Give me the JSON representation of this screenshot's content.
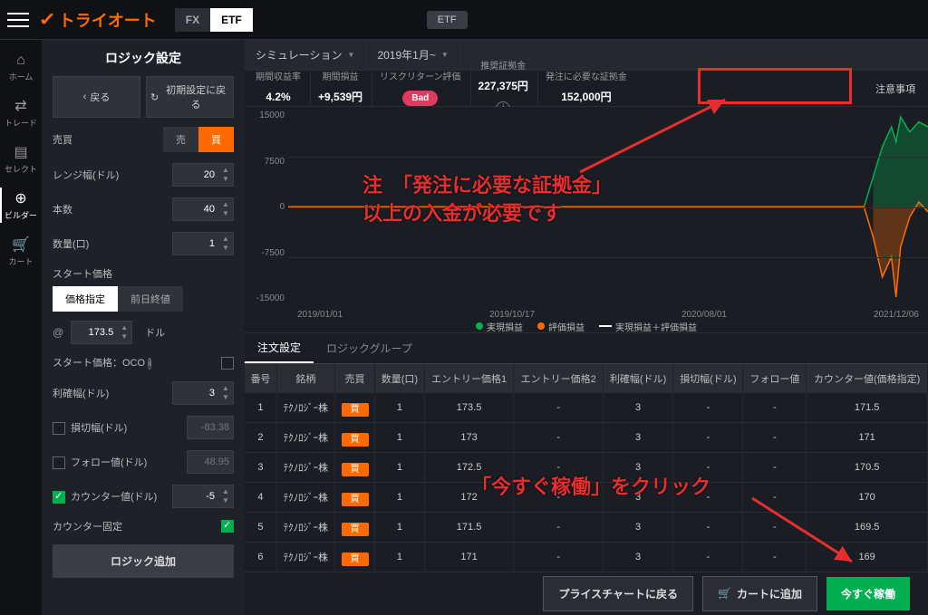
{
  "logo_text": "トライオート",
  "toggle": {
    "fx": "FX",
    "etf": "ETF"
  },
  "etf_pill": "ETF",
  "rail": [
    {
      "icon": "⌂",
      "label": "ホーム"
    },
    {
      "icon": "⇄",
      "label": "トレード"
    },
    {
      "icon": "▤",
      "label": "セレクト"
    },
    {
      "icon": "⊕",
      "label": "ビルダー"
    },
    {
      "icon": "🛒",
      "label": "カート"
    }
  ],
  "sidebar": {
    "title": "ロジック設定",
    "back": "戻る",
    "reset": "初期設定に戻る",
    "buysell_label": "売買",
    "sell": "売",
    "buy": "買",
    "range_label": "レンジ幅(ドル)",
    "range_val": "20",
    "count_label": "本数",
    "count_val": "40",
    "qty_label": "数量(口)",
    "qty_val": "1",
    "start_label": "スタート価格",
    "seg_price": "価格指定",
    "seg_prev": "前日終値",
    "at_val": "173.5",
    "at_unit": "ドル",
    "oco_label": "スタート価格：OCO",
    "tp_label": "利確幅(ドル)",
    "tp_val": "3",
    "sl_label": "損切幅(ドル)",
    "sl_ph": "-83.38",
    "follow_label": "フォロー値(ドル)",
    "follow_ph": "48.95",
    "counter_label": "カウンター値(ドル)",
    "counter_val": "-5",
    "fix_label": "カウンター固定",
    "add_logic": "ロジック追加"
  },
  "sim": {
    "label": "シミュレーション",
    "period": "2019年1月~"
  },
  "metrics": {
    "m1l": "期間収益率",
    "m1v": "4.2%",
    "m2l": "期間損益",
    "m2v": "+9,539円",
    "m3l": "リスクリターン評価",
    "bad": "Bad",
    "m4l": "推奨証拠金",
    "m4v": "227,375円",
    "m5l": "発注に必要な証拠金",
    "m5v": "152,000円",
    "warn": "注意事項"
  },
  "chart_data": {
    "type": "area",
    "ylim": [
      -15000,
      15000
    ],
    "yticks": [
      15000,
      7500,
      0,
      -7500,
      -15000
    ],
    "xticks": [
      "2019/01/01",
      "2019/10/17",
      "2020/08/01",
      "2021/12/06"
    ],
    "legend": [
      {
        "name": "実現損益",
        "color": "#00b050"
      },
      {
        "name": "評価損益",
        "color": "#ff6a00"
      },
      {
        "name": "実現損益＋評価損益",
        "color": "#ffffff"
      }
    ]
  },
  "orders": {
    "tab1": "注文設定",
    "tab2": "ロジックグループ",
    "headers": [
      "番号",
      "銘柄",
      "売買",
      "数量(口)",
      "エントリー価格1",
      "エントリー価格2",
      "利確幅(ドル)",
      "損切幅(ドル)",
      "フォロー値",
      "カウンター値(価格指定)"
    ],
    "rows": [
      {
        "n": "1",
        "sym": "ﾃｸﾉﾛｼﾞｰ株",
        "bs": "買",
        "q": "1",
        "e1": "173.5",
        "e2": "-",
        "tp": "3",
        "sl": "-",
        "f": "-",
        "c": "171.5"
      },
      {
        "n": "2",
        "sym": "ﾃｸﾉﾛｼﾞｰ株",
        "bs": "買",
        "q": "1",
        "e1": "173",
        "e2": "-",
        "tp": "3",
        "sl": "-",
        "f": "-",
        "c": "171"
      },
      {
        "n": "3",
        "sym": "ﾃｸﾉﾛｼﾞｰ株",
        "bs": "買",
        "q": "1",
        "e1": "172.5",
        "e2": "-",
        "tp": "3",
        "sl": "-",
        "f": "-",
        "c": "170.5"
      },
      {
        "n": "4",
        "sym": "ﾃｸﾉﾛｼﾞｰ株",
        "bs": "買",
        "q": "1",
        "e1": "172",
        "e2": "-",
        "tp": "3",
        "sl": "-",
        "f": "-",
        "c": "170"
      },
      {
        "n": "5",
        "sym": "ﾃｸﾉﾛｼﾞｰ株",
        "bs": "買",
        "q": "1",
        "e1": "171.5",
        "e2": "-",
        "tp": "3",
        "sl": "-",
        "f": "-",
        "c": "169.5"
      },
      {
        "n": "6",
        "sym": "ﾃｸﾉﾛｼﾞｰ株",
        "bs": "買",
        "q": "1",
        "e1": "171",
        "e2": "-",
        "tp": "3",
        "sl": "-",
        "f": "-",
        "c": "169"
      }
    ]
  },
  "footer": {
    "back_chart": "プライスチャートに戻る",
    "add_cart": "カートに追加",
    "run": "今すぐ稼働"
  },
  "annotations": {
    "a1": "注　「発注に必要な証拠金」\n以上の入金が必要です",
    "a2": "「今すぐ稼働」をクリック"
  }
}
